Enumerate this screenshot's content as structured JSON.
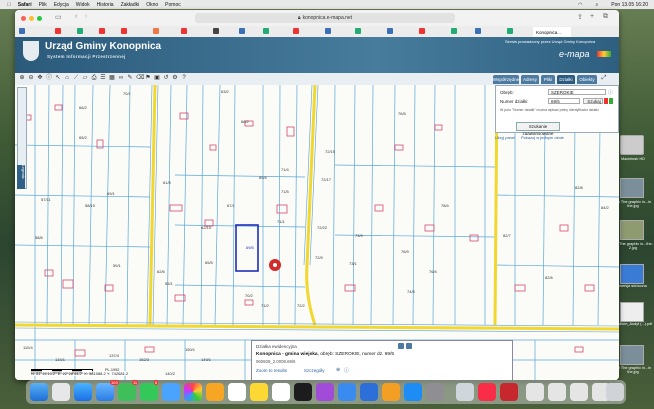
{
  "menubar": {
    "apple": "",
    "app": "Safari",
    "items": [
      "Plik",
      "Edycja",
      "Widok",
      "Historia",
      "Zakładki",
      "Okno",
      "Pomoc"
    ],
    "clock": "Pon 13.05  16:20"
  },
  "browser": {
    "url": "konopnica.e-mapa.net",
    "tab_label": "Konopnica..."
  },
  "site": {
    "title": "Urząd Gminy Konopnica",
    "subtitle": "System Informacji Przestrzennej",
    "note": "Serwis prowadzony przez Urząd Gminy Konopnica",
    "brand": "e-mapa"
  },
  "panel_tabs": [
    "Współrzędne",
    "Adresy",
    "Pliki",
    "Działki",
    "Obiekty"
  ],
  "search": {
    "obreb_label": "Obręb:",
    "obreb_value": "SZEROKIE",
    "numer_label": "Numer działki:",
    "numer_value": "69/5",
    "search_button": "Szukaj",
    "hint": "W polu \"Numer działki\" można wpisać pełny identyfikator działki",
    "advanced_button": "Szukanie zaawansowane",
    "hide_panel": "Ukryj panel",
    "show_in_window": "Pokazuj w jednym oknie"
  },
  "info": {
    "header": "Działka ewidencyjna",
    "line1_prefix": "Konopnica - gmina wiejska",
    "line1_rest": ", obręb: SZEROKIE, numer dz. 69/5",
    "line2": "060608_2.0008.69/5",
    "links": [
      "Zoom to results",
      "Szczegóły"
    ],
    "icons": [
      "⊕",
      "ⓘ"
    ]
  },
  "coords": "N: 51°15'10.2\"  E: 22°28'44.2\"   X: 381068.2   Y: 742681.2",
  "scale_label": "PL-1992",
  "map_labels": [
    {
      "t": "66/2"
    },
    {
      "t": "65/2"
    },
    {
      "t": "69/1"
    },
    {
      "t": "70/1"
    },
    {
      "t": "61/5"
    },
    {
      "t": "63/2"
    },
    {
      "t": "68/2"
    },
    {
      "t": "69/4"
    },
    {
      "t": "69/5"
    },
    {
      "t": "71/1"
    },
    {
      "t": "71/4"
    },
    {
      "t": "71/5"
    },
    {
      "t": "72/15"
    },
    {
      "t": "72/17"
    },
    {
      "t": "72/22"
    },
    {
      "t": "72/9"
    },
    {
      "t": "73/9"
    },
    {
      "t": "76/5"
    },
    {
      "t": "76/9"
    },
    {
      "t": "78/4"
    },
    {
      "t": "82/7"
    },
    {
      "t": "82/8"
    },
    {
      "t": "82/6"
    },
    {
      "t": "84/2"
    },
    {
      "t": "62/10"
    },
    {
      "t": "57/11"
    },
    {
      "t": "58/10"
    },
    {
      "t": "58/6"
    },
    {
      "t": "59/1"
    },
    {
      "t": "65/5"
    },
    {
      "t": "67/1"
    },
    {
      "t": "70/2"
    },
    {
      "t": "71/2"
    },
    {
      "t": "72/2"
    },
    {
      "t": "73/1"
    },
    {
      "t": "74/5"
    },
    {
      "t": "76/4"
    },
    {
      "t": "62/6"
    },
    {
      "t": "149/1"
    },
    {
      "t": "150/1"
    },
    {
      "t": "152/3"
    },
    {
      "t": "134/1"
    },
    {
      "t": "137/4"
    },
    {
      "t": "140/2"
    },
    {
      "t": "110/4"
    },
    {
      "t": "121/2"
    },
    {
      "t": "55/1"
    }
  ],
  "dock_badges": [
    "103",
    "11",
    "6"
  ],
  "desktop_files": [
    {
      "label": "Macintosh HD"
    },
    {
      "label": "Fly The graphic in...in the.jpg"
    },
    {
      "label": "Fly The graphic in...the-2.jpg"
    },
    {
      "label": "wersja skrócona"
    },
    {
      "label": "Kindlum_Audyt (...).pdf"
    },
    {
      "label": "Fly The graphic in...in the.jpg"
    }
  ],
  "colors": {
    "header": "#2b5a7b",
    "road": "#f2d72e",
    "parcel": "#5aa8d8",
    "building": "#d64b6b",
    "selected": "#1f2fb8"
  }
}
